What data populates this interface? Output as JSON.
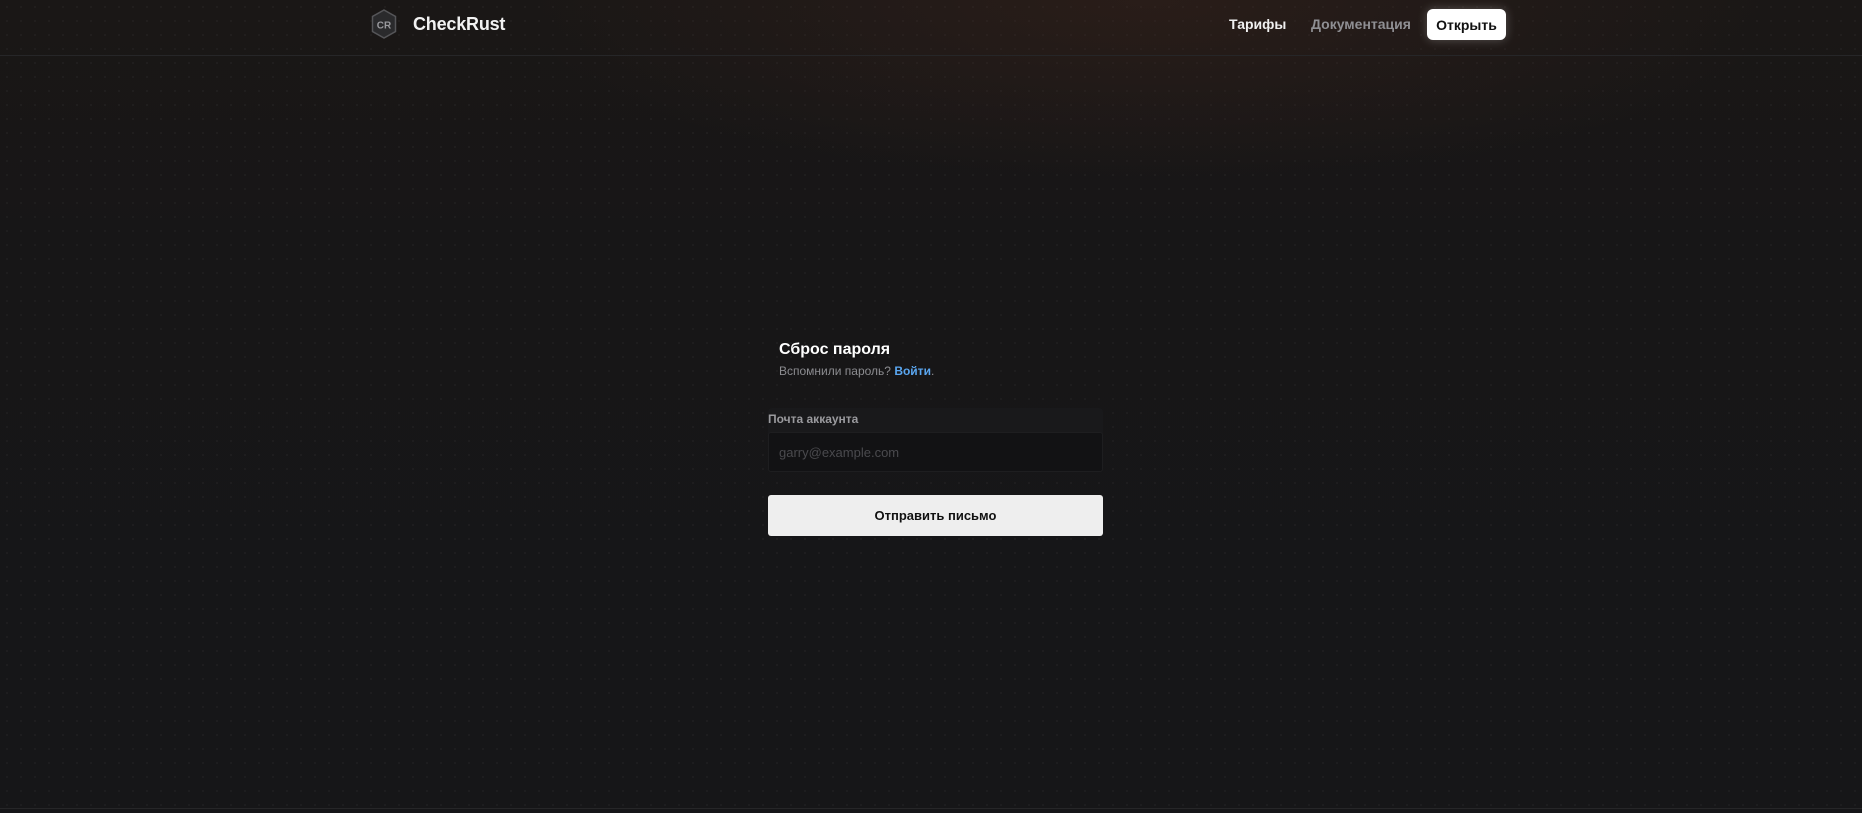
{
  "header": {
    "brand": "CheckRust",
    "logo_text": "CR",
    "nav": {
      "pricing": "Тарифы",
      "docs": "Документация"
    },
    "open_button": "Открыть"
  },
  "form": {
    "title": "Сброс пароля",
    "subtitle_prefix": "Вспомнили пароль? ",
    "login_link": "Войти",
    "subtitle_suffix": ".",
    "email_label": "Почта аккаунта",
    "email_placeholder": "garry@example.com",
    "email_value": "",
    "submit_button": "Отправить письмо"
  },
  "icons": {
    "logo": "hexagon-logo-icon"
  },
  "colors": {
    "background": "#161618",
    "link": "#5aa6f0",
    "button_primary": "#eeeeee",
    "text": "#e8e8ea"
  }
}
